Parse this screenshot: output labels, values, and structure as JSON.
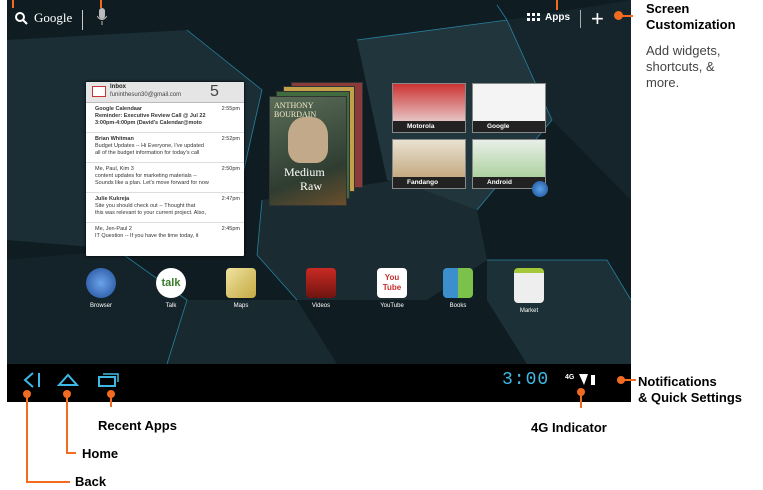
{
  "search": {
    "label": "Google"
  },
  "topbar": {
    "apps_label": "Apps",
    "add_label": "+"
  },
  "email_widget": {
    "title": "Inbox",
    "account": "funinthesun30@gmail.com",
    "count": "5",
    "messages": [
      {
        "sender": "Google Calendaar",
        "time": "2:55pm",
        "subject": "Reminder: Executive Review Call @ Jul 22",
        "preview": "3:00pm-4:00pm (David's Calendar@moto"
      },
      {
        "sender": "Brian Whitman",
        "time": "2:52pm",
        "subject": "Budget Updates -- Hi Everyone, I've updated",
        "preview": "all of the budget information for today's call"
      },
      {
        "sender": "Me, Paul, Kim  3",
        "time": "2:50pm",
        "subject": "content updates for marketing materials --",
        "preview": "Sounds like a plan. Let's move forward for now"
      },
      {
        "sender": "Julie Kukreja",
        "time": "2:47pm",
        "subject": "Site you should check out -- Thought that",
        "preview": "this was relevant to your current project. Also,"
      },
      {
        "sender": "Me, Jen-Paul  2",
        "time": "2:45pm",
        "subject": "IT Question -- If you have the time today, it",
        "preview": ""
      }
    ]
  },
  "book": {
    "author": "ANTHONY BOURDAIN",
    "title_line1": "Medium",
    "title_line2": "Raw"
  },
  "bookmarks": [
    {
      "label": "Motorola"
    },
    {
      "label": "Google"
    },
    {
      "label": "Fandango"
    },
    {
      "label": "Android"
    }
  ],
  "dock": [
    {
      "label": "Browser",
      "icon": "globe-icon",
      "color": "#2b5ba8"
    },
    {
      "label": "Talk",
      "icon": "talk-icon",
      "color": "#ffffff"
    },
    {
      "label": "Maps",
      "icon": "maps-icon",
      "color": "#e8d27a"
    },
    {
      "label": "Videos",
      "icon": "film-icon",
      "color": "#b3221d"
    },
    {
      "label": "YouTube",
      "icon": "youtube-icon",
      "color": "#c4302b"
    },
    {
      "label": "Books",
      "icon": "book-icon",
      "color": "#3b8fcd"
    },
    {
      "label": "Market",
      "icon": "market-bag-icon",
      "color": "#a4c639"
    }
  ],
  "status": {
    "time": "3:00",
    "network": "4G"
  },
  "callouts": {
    "screen_customization_title": "Screen Customization",
    "screen_customization_line1": "Add widgets,",
    "screen_customization_line2": "shortcuts, &",
    "screen_customization_line3": "more.",
    "notifications_line1": "Notifications",
    "notifications_line2": "& Quick Settings",
    "recent_apps": "Recent Apps",
    "home": "Home",
    "back": "Back",
    "g4_indicator": "4G Indicator"
  },
  "colors": {
    "callout": "#f26b21",
    "clock": "#3fb8e6"
  }
}
